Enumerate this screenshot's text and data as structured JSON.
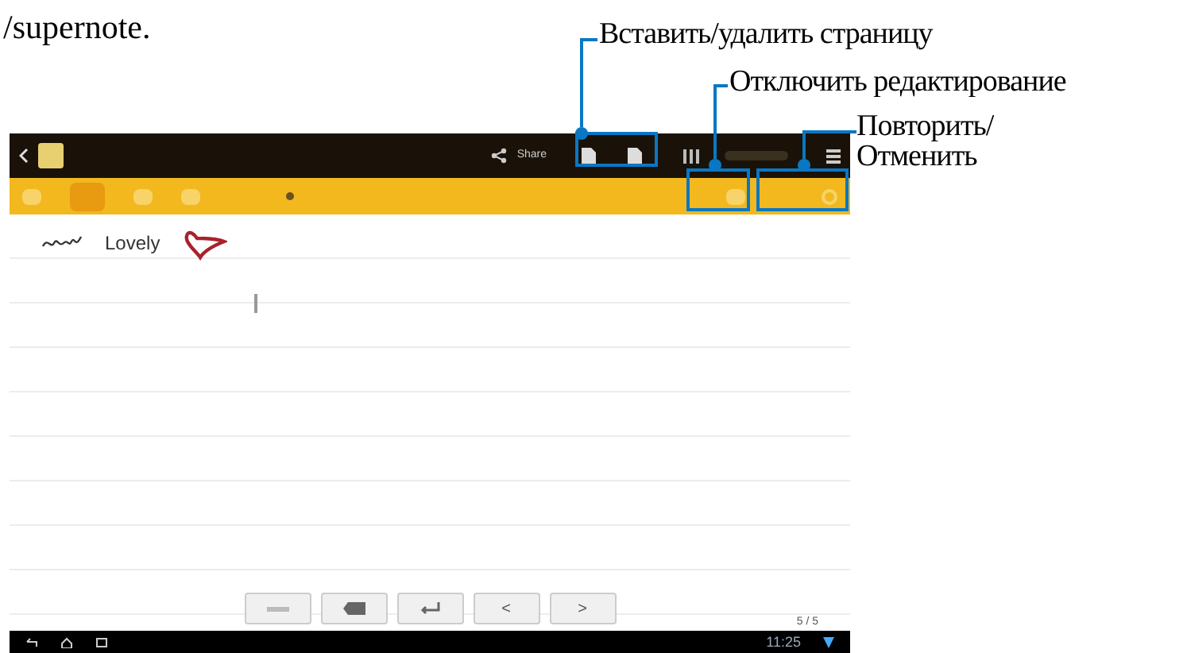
{
  "document_text": "/supernote.",
  "callouts": [
    {
      "label": "Вставить/удалить страницу"
    },
    {
      "label": "Отключить редактирование"
    },
    {
      "label": "Повторить/ Отменить"
    }
  ],
  "app": {
    "action_bar": {
      "share": "Share"
    },
    "note": {
      "typed_word": "Lovely"
    },
    "keys": [
      {
        "kind": "space"
      },
      {
        "kind": "backspace"
      },
      {
        "kind": "enter"
      },
      {
        "kind": "text",
        "label": "<"
      },
      {
        "kind": "text",
        "label": ">"
      }
    ],
    "page_indicator": "5 / 5",
    "status_bar": {
      "clock": "11:25"
    }
  }
}
